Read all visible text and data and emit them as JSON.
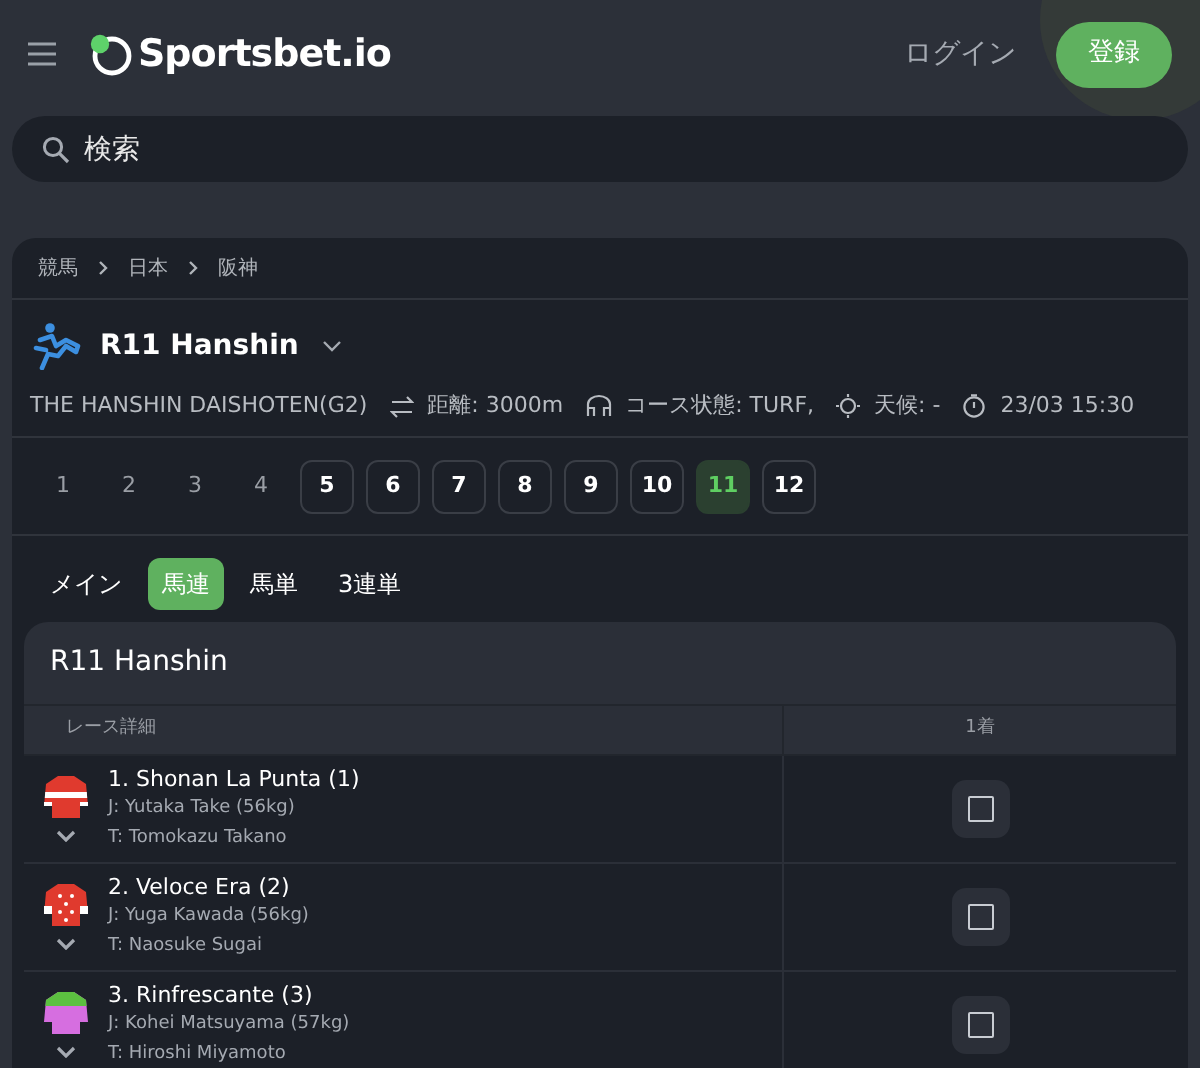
{
  "header": {
    "logo": "Sportsbet.io",
    "login": "ログイン",
    "register": "登録"
  },
  "search": {
    "placeholder": "検索"
  },
  "breadcrumb": [
    "競馬",
    "日本",
    "阪神"
  ],
  "event": {
    "title": "R11 Hanshin",
    "race_name": "THE HANSHIN DAISHOTEN(G2)",
    "distance": "距離: 3000m",
    "course": "コース状態: TURF,",
    "weather": "天候: -",
    "time": "23/03 15:30"
  },
  "races": [
    {
      "label": "1",
      "disabled": true,
      "selected": false
    },
    {
      "label": "2",
      "disabled": true,
      "selected": false
    },
    {
      "label": "3",
      "disabled": true,
      "selected": false
    },
    {
      "label": "4",
      "disabled": true,
      "selected": false
    },
    {
      "label": "5",
      "disabled": false,
      "selected": false
    },
    {
      "label": "6",
      "disabled": false,
      "selected": false
    },
    {
      "label": "7",
      "disabled": false,
      "selected": false
    },
    {
      "label": "8",
      "disabled": false,
      "selected": false
    },
    {
      "label": "9",
      "disabled": false,
      "selected": false
    },
    {
      "label": "10",
      "disabled": false,
      "selected": false
    },
    {
      "label": "11",
      "disabled": false,
      "selected": true
    },
    {
      "label": "12",
      "disabled": false,
      "selected": false
    }
  ],
  "tabs": [
    {
      "label": "メイン",
      "selected": false
    },
    {
      "label": "馬連",
      "selected": true
    },
    {
      "label": "馬単",
      "selected": false
    },
    {
      "label": "3連単",
      "selected": false
    }
  ],
  "market": {
    "title": "R11 Hanshin",
    "columns": [
      "レース詳細",
      "1着"
    ],
    "runners": [
      {
        "name": "1. Shonan La Punta (1)",
        "jockey": "J: Yutaka Take (56kg)",
        "trainer": "T: Tomokazu Takano",
        "kind": "hoops",
        "color": "#e03a2e",
        "checked": false
      },
      {
        "name": "2. Veloce Era (2)",
        "jockey": "J: Yuga Kawada (56kg)",
        "trainer": "T: Naosuke Sugai",
        "kind": "spots",
        "color": "#e03a2e",
        "checked": false
      },
      {
        "name": "3. Rinfrescante (3)",
        "jockey": "J: Kohei Matsuyama (57kg)",
        "trainer": "T: Hiroshi Miyamoto",
        "kind": "collar",
        "color": "#d66ee0",
        "checked": false
      }
    ]
  }
}
